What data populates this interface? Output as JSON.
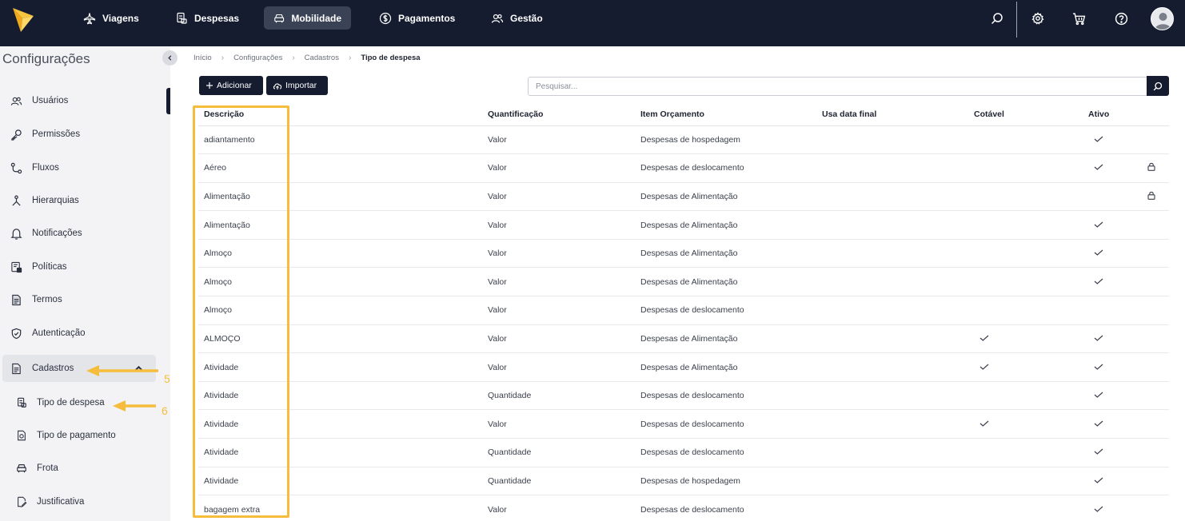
{
  "topbar": {
    "nav": [
      {
        "label": "Viagens",
        "icon": "plane-icon"
      },
      {
        "label": "Despesas",
        "icon": "receipt-icon"
      },
      {
        "label": "Mobilidade",
        "icon": "car-icon"
      },
      {
        "label": "Pagamentos",
        "icon": "dollar-circle-icon"
      },
      {
        "label": "Gestão",
        "icon": "users-icon"
      }
    ]
  },
  "sidebar": {
    "title": "Configurações",
    "items": [
      {
        "label": "Usuários"
      },
      {
        "label": "Permissões"
      },
      {
        "label": "Fluxos"
      },
      {
        "label": "Hierarquias"
      },
      {
        "label": "Notificações"
      },
      {
        "label": "Políticas"
      },
      {
        "label": "Termos"
      },
      {
        "label": "Autenticação"
      },
      {
        "label": "Cadastros"
      }
    ],
    "subitems": [
      {
        "label": "Tipo de despesa"
      },
      {
        "label": "Tipo de pagamento"
      },
      {
        "label": "Frota"
      },
      {
        "label": "Justificativa"
      }
    ]
  },
  "breadcrumb": [
    "Início",
    "Configurações",
    "Cadastros",
    "Tipo de despesa"
  ],
  "toolbar": {
    "add_label": "Adicionar",
    "import_label": "Importar",
    "search_placeholder": "Pesquisar..."
  },
  "table": {
    "headers": [
      "Descrição",
      "Quantificação",
      "Item Orçamento",
      "Usa data final",
      "Cotável",
      "Ativo"
    ],
    "rows": [
      {
        "descricao": "adiantamento",
        "quantificacao": "Valor",
        "item": "Despesas de hospedagem",
        "cotavel": false,
        "ativo": true,
        "locked": false
      },
      {
        "descricao": "Aéreo",
        "quantificacao": "Valor",
        "item": "Despesas de deslocamento",
        "cotavel": false,
        "ativo": true,
        "locked": true
      },
      {
        "descricao": "Alimentação",
        "quantificacao": "Valor",
        "item": "Despesas de Alimentação",
        "cotavel": false,
        "ativo": false,
        "locked": true
      },
      {
        "descricao": "Alimentação",
        "quantificacao": "Valor",
        "item": "Despesas de Alimentação",
        "cotavel": false,
        "ativo": true,
        "locked": false
      },
      {
        "descricao": "Almoço",
        "quantificacao": "Valor",
        "item": "Despesas de Alimentação",
        "cotavel": false,
        "ativo": true,
        "locked": false
      },
      {
        "descricao": "Almoço",
        "quantificacao": "Valor",
        "item": "Despesas de Alimentação",
        "cotavel": false,
        "ativo": true,
        "locked": false
      },
      {
        "descricao": "Almoço",
        "quantificacao": "Valor",
        "item": "Despesas de deslocamento",
        "cotavel": false,
        "ativo": false,
        "locked": false
      },
      {
        "descricao": "ALMOÇO",
        "quantificacao": "Valor",
        "item": "Despesas de Alimentação",
        "cotavel": true,
        "ativo": true,
        "locked": false
      },
      {
        "descricao": "Atividade",
        "quantificacao": "Valor",
        "item": "Despesas de Alimentação",
        "cotavel": true,
        "ativo": true,
        "locked": false
      },
      {
        "descricao": "Atividade",
        "quantificacao": "Quantidade",
        "item": "Despesas de deslocamento",
        "cotavel": false,
        "ativo": true,
        "locked": false
      },
      {
        "descricao": "Atividade",
        "quantificacao": "Valor",
        "item": "Despesas de deslocamento",
        "cotavel": true,
        "ativo": true,
        "locked": false
      },
      {
        "descricao": "Atividade",
        "quantificacao": "Quantidade",
        "item": "Despesas de deslocamento",
        "cotavel": false,
        "ativo": true,
        "locked": false
      },
      {
        "descricao": "Atividade",
        "quantificacao": "Quantidade",
        "item": "Despesas de hospedagem",
        "cotavel": false,
        "ativo": true,
        "locked": false
      },
      {
        "descricao": "bagagem extra",
        "quantificacao": "Valor",
        "item": "Despesas de deslocamento",
        "cotavel": false,
        "ativo": true,
        "locked": false
      }
    ]
  },
  "annotations": {
    "step5": "5",
    "step6": "6",
    "color": "#f6bd3c"
  },
  "colors": {
    "topbar": "#151c30",
    "sidebar": "#f3f3f5",
    "accent": "#f6bd3c"
  }
}
